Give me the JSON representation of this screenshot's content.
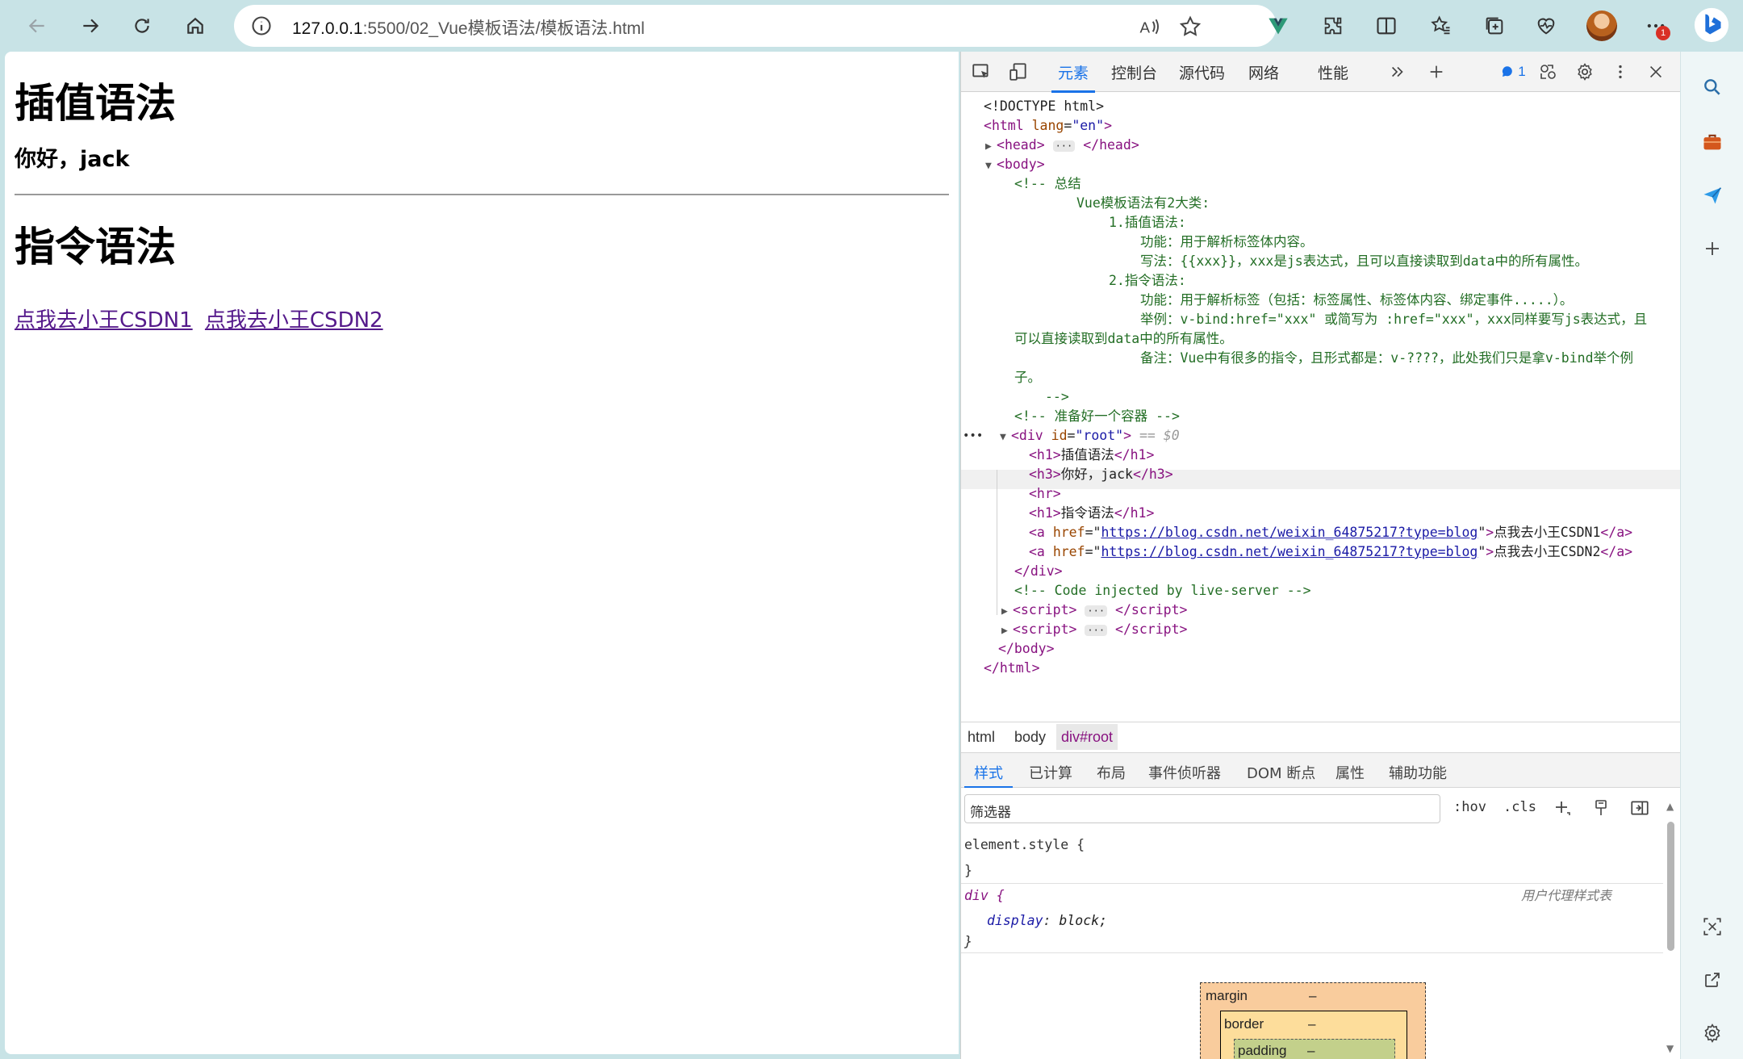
{
  "browser": {
    "url_host": "127.0.0.1",
    "url_path": ":5500/02_Vue模板语法/模板语法.html",
    "notification_count": "1"
  },
  "page": {
    "h1_interp": "插值语法",
    "h3_greeting": "你好，jack",
    "h1_directive": "指令语法",
    "link1": "点我去小王CSDN1",
    "link2": "点我去小王CSDN2"
  },
  "devtools": {
    "tabs": [
      "元素",
      "控制台",
      "源代码",
      "网络",
      "性能"
    ],
    "issues_count": "1",
    "dom": {
      "doctype": "<!DOCTYPE html>",
      "html_open": "html",
      "lang_attr": "lang",
      "lang_val": "\"en\"",
      "head": "head",
      "body": "body",
      "comment_open": "<!-- 总结",
      "c1": "Vue模板语法有2大类:",
      "c2": "1.插值语法:",
      "c3": "功能：用于解析标签体内容。",
      "c4": "写法：{{xxx}}，xxx是js表达式，且可以直接读取到data中的所有属性。",
      "c5": "2.指令语法:",
      "c6": "功能：用于解析标签（包括：标签属性、标签体内容、绑定事件.....）。",
      "c7": "举例：v-bind:href=\"xxx\" 或简写为 :href=\"xxx\"，xxx同样要写js表达式，且",
      "c7b": "可以直接读取到data中的所有属性。",
      "c8": "备注：Vue中有很多的指令，且形式都是：v-????，此处我们只是拿v-bind举个例",
      "c8b": "子。",
      "comment_close": "-->",
      "comment_container": "<!-- 准备好一个容器 -->",
      "div_id_val": "\"root\"",
      "eq0": "== $0",
      "h1a_text": "插值语法",
      "h3_text": "你好，jack",
      "h1b_text": "指令语法",
      "href_val": "https://blog.csdn.net/weixin_64875217?type=blog",
      "a1_text": "点我去小王CSDN1",
      "a2_text": "点我去小王CSDN2",
      "live_comment": "<!-- Code injected by live-server -->"
    },
    "breadcrumbs": [
      "html",
      "body",
      "div#root"
    ],
    "subtabs": [
      "样式",
      "已计算",
      "布局",
      "事件侦听器",
      "DOM 断点",
      "属性",
      "辅助功能"
    ],
    "filter_placeholder": "筛选器",
    "hov": ":hov",
    "cls": ".cls",
    "styles": {
      "element_style": "element.style {",
      "close": "}",
      "div_selector": "div {",
      "ua_label": "用户代理样式表",
      "display_prop": "display",
      "display_val": "block;"
    },
    "boxmodel": {
      "margin": "margin",
      "border": "border",
      "padding": "padding",
      "dash": "–"
    }
  }
}
